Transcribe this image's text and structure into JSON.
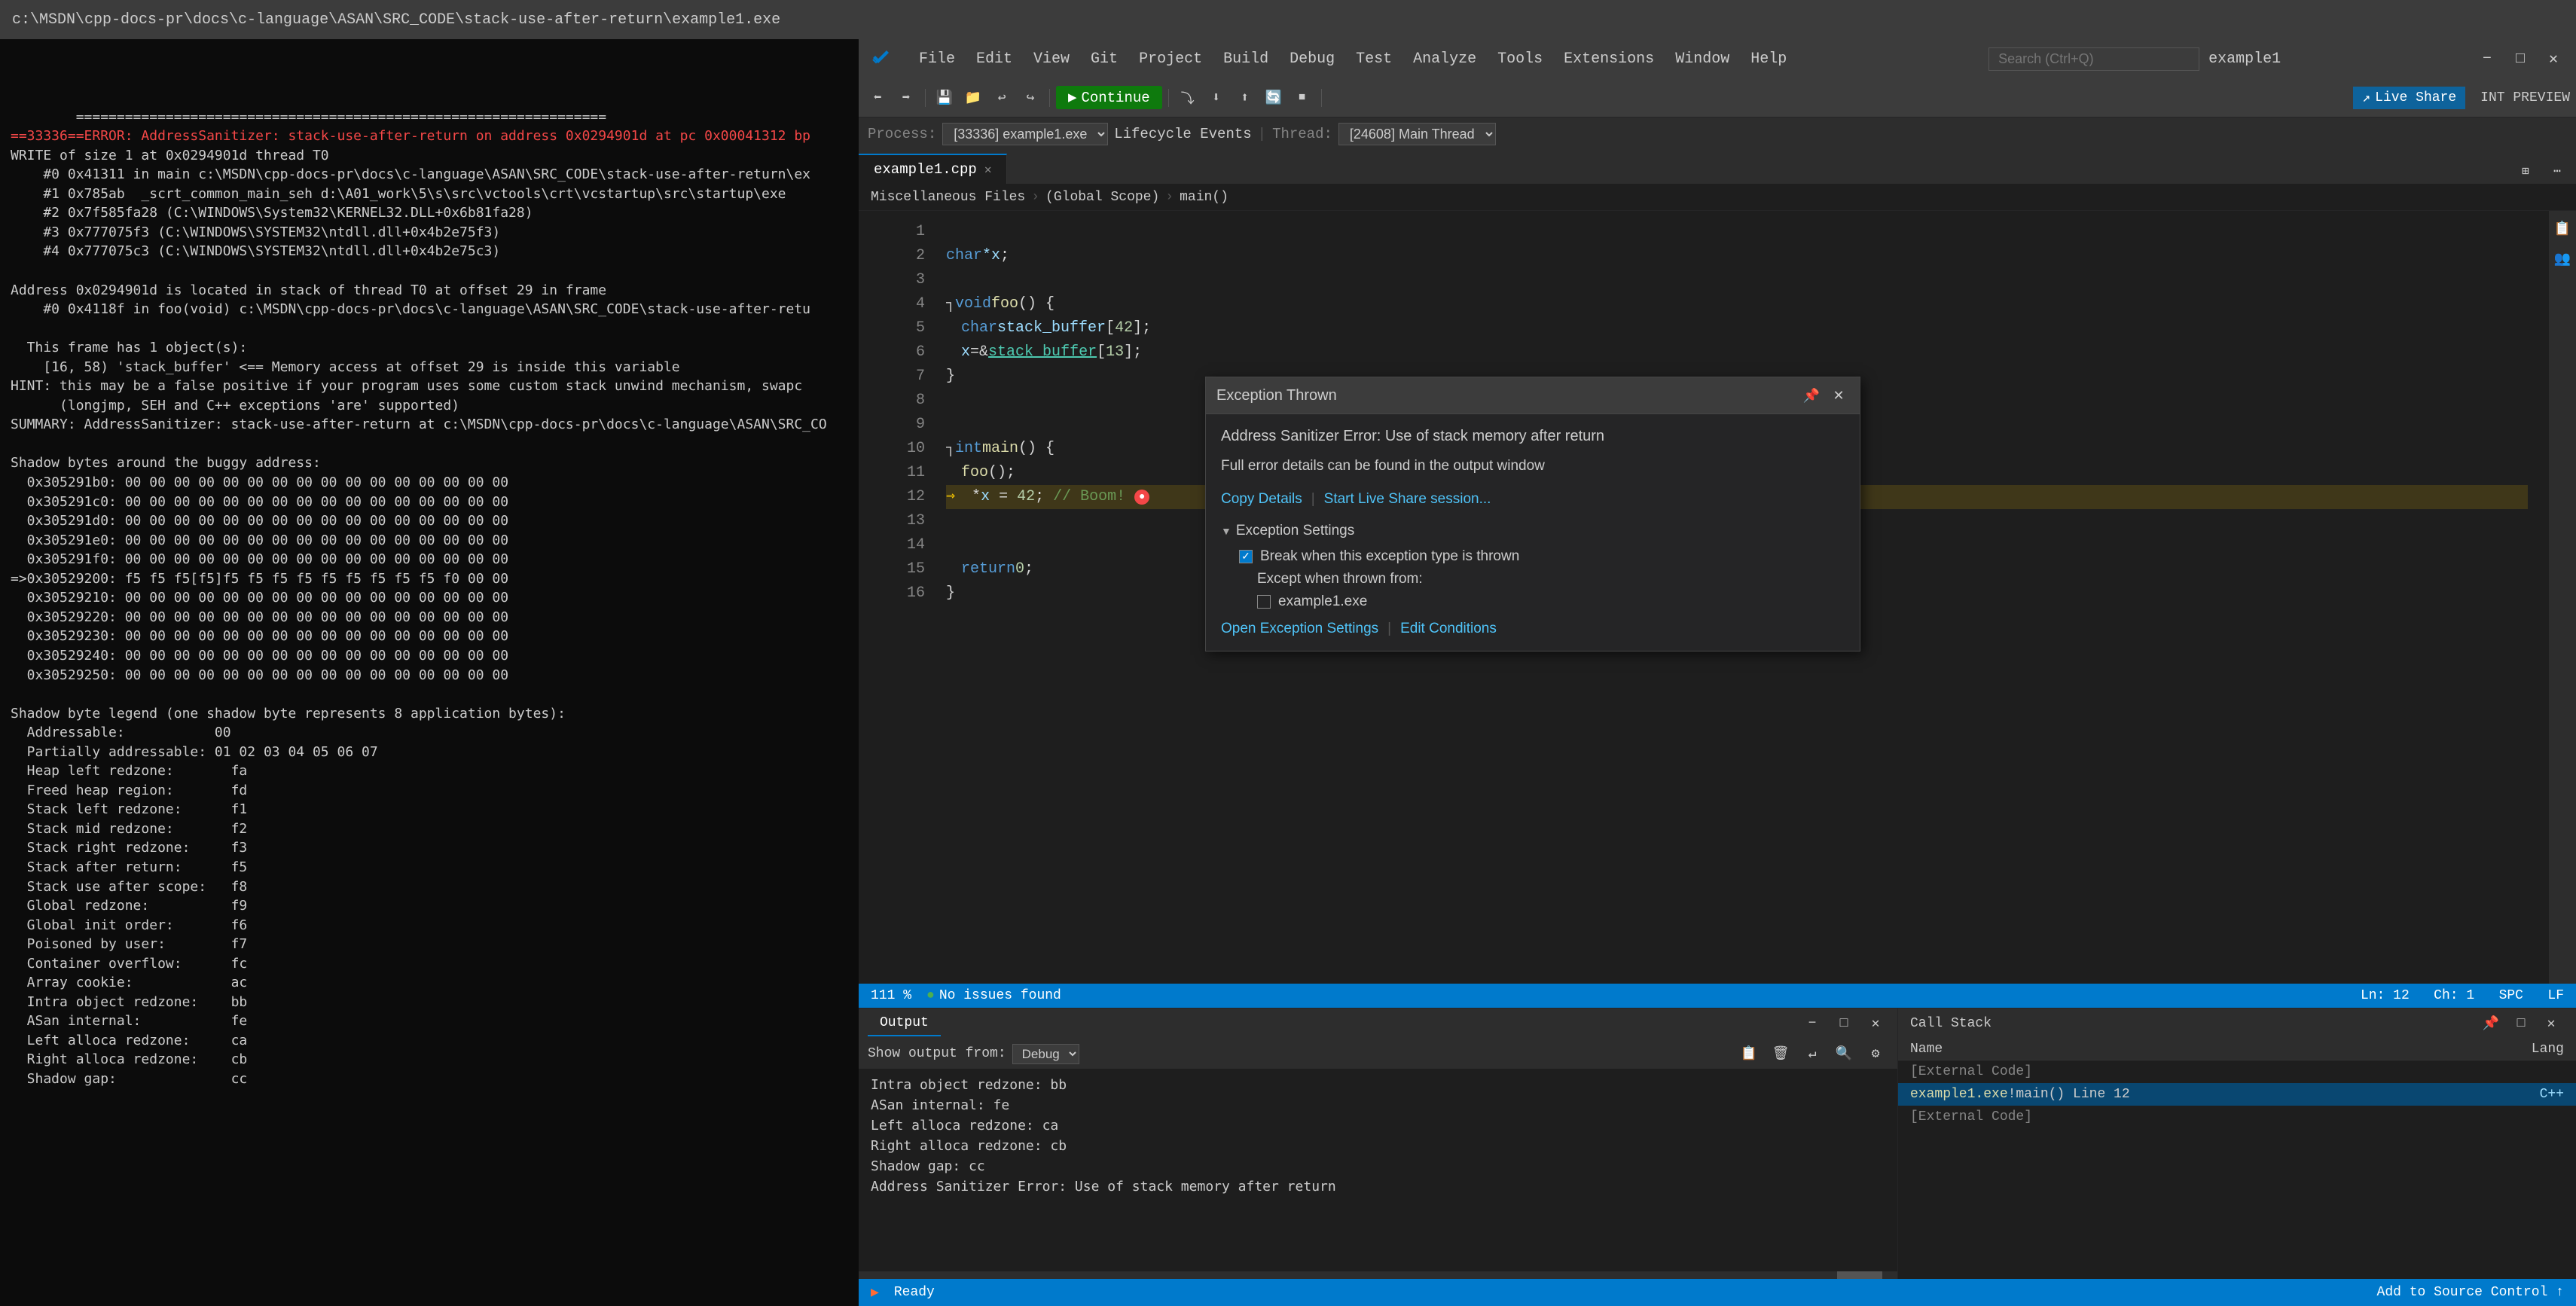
{
  "title_bar": {
    "text": "c:\\MSDN\\cpp-docs-pr\\docs\\c-language\\ASAN\\SRC_CODE\\stack-use-after-return\\example1.exe"
  },
  "terminal": {
    "lines": [
      "=================================================================",
      "==33336==ERROR: AddressSanitizer: stack-use-after-return on address 0x0294901d at pc 0x00041312 bp",
      "WRITE of size 1 at 0x0294901d thread T0",
      "    #0 0x41311 in main c:\\MSDN\\cpp-docs-pr\\docs\\c-language\\ASAN\\SRC_CODE\\stack-use-after-return\\ex",
      "    #1 0x785ab  _scrt_common_main_seh d:\\A01_work\\5\\s\\src\\vctools\\crt\\vcstartup\\src\\startup\\exe",
      "    #2 0x7f585fa28 (C:\\WINDOWS\\System32\\KERNEL32.DLL+0x6b81fa28)",
      "    #3 0x777075f3 (C:\\WINDOWS\\SYSTEM32\\ntdll.dll+0x4b2e75f3)",
      "    #4 0x777075c3 (C:\\WINDOWS\\SYSTEM32\\ntdll.dll+0x4b2e75c3)",
      "",
      "Address 0x0294901d is located in stack of thread T0 at offset 29 in frame",
      "    #0 0x4118f in foo(void) c:\\MSDN\\cpp-docs-pr\\docs\\c-language\\ASAN\\SRC_CODE\\stack-use-after-retu",
      "",
      "  This frame has 1 object(s):",
      "    [16, 58) 'stack_buffer' <== Memory access at offset 29 is inside this variable",
      "HINT: this may be a false positive if your program uses some custom stack unwind mechanism, swapc",
      "      (longjmp, SEH and C++ exceptions 'are' supported)",
      "SUMMARY: AddressSanitizer: stack-use-after-return at c:\\MSDN\\cpp-docs-pr\\docs\\c-language\\ASAN\\SRC_CO",
      "",
      "Shadow bytes around the buggy address:",
      "  0x305291b0: 00 00 00 00 00 00 00 00 00 00 00 00 00 00 00 00",
      "  0x305291c0: 00 00 00 00 00 00 00 00 00 00 00 00 00 00 00 00",
      "  0x305291d0: 00 00 00 00 00 00 00 00 00 00 00 00 00 00 00 00",
      "  0x305291e0: 00 00 00 00 00 00 00 00 00 00 00 00 00 00 00 00",
      "  0x305291f0: 00 00 00 00 00 00 00 00 00 00 00 00 00 00 00 00",
      "=>0x30529200: f5 f5 f5[f5]f5 f5 f5 f5 f5 f5 f5 f5 f5 f0 00 00",
      "  0x30529210: 00 00 00 00 00 00 00 00 00 00 00 00 00 00 00 00",
      "  0x30529220: 00 00 00 00 00 00 00 00 00 00 00 00 00 00 00 00",
      "  0x30529230: 00 00 00 00 00 00 00 00 00 00 00 00 00 00 00 00",
      "  0x30529240: 00 00 00 00 00 00 00 00 00 00 00 00 00 00 00 00",
      "  0x30529250: 00 00 00 00 00 00 00 00 00 00 00 00 00 00 00 00",
      "",
      "Shadow byte legend (one shadow byte represents 8 application bytes):",
      "  Addressable:           00",
      "  Partially addressable: 01 02 03 04 05 06 07",
      "  Heap left redzone:       fa",
      "  Freed heap region:       fd",
      "  Stack left redzone:      f1",
      "  Stack mid redzone:       f2",
      "  Stack right redzone:     f3",
      "  Stack after return:      f5",
      "  Stack use after scope:   f8",
      "  Global redzone:          f9",
      "  Global init order:       f6",
      "  Poisoned by user:        f7",
      "  Container overflow:      fc",
      "  Array cookie:            ac",
      "  Intra object redzone:    bb",
      "  ASan internal:           fe",
      "  Left alloca redzone:     ca",
      "  Right alloca redzone:    cb",
      "  Shadow gap:              cc"
    ]
  },
  "vscode": {
    "menu": {
      "items": [
        "File",
        "Edit",
        "View",
        "Git",
        "Project",
        "Build",
        "Debug",
        "Test",
        "Analyze",
        "Tools",
        "Extensions",
        "Window",
        "Help"
      ]
    },
    "search_placeholder": "Search (Ctrl+Q)",
    "title": "example1",
    "window_buttons": {
      "minimize": "−",
      "maximize": "□",
      "close": "✕"
    },
    "toolbar": {
      "continue_label": "Continue",
      "live_share_label": "Live Share",
      "int_preview": "INT PREVIEW"
    },
    "debug_bar": {
      "process": "Process:",
      "process_value": "[33336] example1.exe",
      "lifecycle": "Lifecycle Events",
      "thread_label": "Thread:",
      "thread_value": "[24608] Main Thread"
    },
    "tabs": [
      {
        "label": "example1.cpp",
        "active": true,
        "close": "✕"
      }
    ],
    "breadcrumb": {
      "folder": "Miscellaneous Files",
      "scope": "(Global Scope)",
      "function": "main()"
    },
    "code": {
      "lines": [
        {
          "num": 1,
          "content": ""
        },
        {
          "num": 2,
          "content": "    char *x;"
        },
        {
          "num": 3,
          "content": ""
        },
        {
          "num": 4,
          "content": "void foo() {"
        },
        {
          "num": 5,
          "content": "    char stack_buffer[42];"
        },
        {
          "num": 6,
          "content": "    x = &stack_buffer[13];"
        },
        {
          "num": 7,
          "content": "}"
        },
        {
          "num": 8,
          "content": ""
        },
        {
          "num": 9,
          "content": ""
        },
        {
          "num": 10,
          "content": "int main() {"
        },
        {
          "num": 11,
          "content": "    foo();"
        },
        {
          "num": 12,
          "content": "    *x = 42; // Boom!",
          "highlighted": true,
          "debug": true
        },
        {
          "num": 13,
          "content": ""
        },
        {
          "num": 14,
          "content": ""
        },
        {
          "num": 15,
          "content": "    return 0;"
        },
        {
          "num": 16,
          "content": "}"
        }
      ]
    }
  },
  "exception_popup": {
    "title": "Exception Thrown",
    "error_title": "Address Sanitizer Error: Use of stack memory after return",
    "details": "Full error details can be found in the output window",
    "copy_details_label": "Copy Details",
    "live_share_label": "Start Live Share session...",
    "settings_title": "Exception Settings",
    "checkbox1_label": "Break when this exception type is thrown",
    "checkbox1_checked": true,
    "indent_label": "Except when thrown from:",
    "checkbox2_label": "example1.exe",
    "checkbox2_checked": false,
    "open_exception_settings": "Open Exception Settings",
    "edit_conditions": "Edit Conditions"
  },
  "status_bar": {
    "ready": "Ready",
    "no_issues": "No issues found",
    "zoom": "111 %",
    "line": "Ln: 12",
    "col": "Ch: 1",
    "spc": "SPC",
    "lf": "LF",
    "add_to_source": "Add to Source Control ↑"
  },
  "output_panel": {
    "title": "Output",
    "show_output_from": "Show output from:",
    "output_source": "Debug",
    "content": [
      "    Intra object redzone:    bb",
      "    ASan internal:           fe",
      "    Left alloca redzone:     ca",
      "    Right alloca redzone:    cb",
      "    Shadow gap:              cc",
      "Address Sanitizer Error: Use of stack memory after return"
    ]
  },
  "call_stack_panel": {
    "title": "Call Stack",
    "columns": [
      "Name",
      "Lang"
    ],
    "rows": [
      {
        "name": "[External Code]",
        "lang": "",
        "selected": false
      },
      {
        "name": "example1.exe!main() Line 12",
        "lang": "C++",
        "selected": true
      },
      {
        "name": "[External Code]",
        "lang": "",
        "selected": false
      }
    ]
  }
}
